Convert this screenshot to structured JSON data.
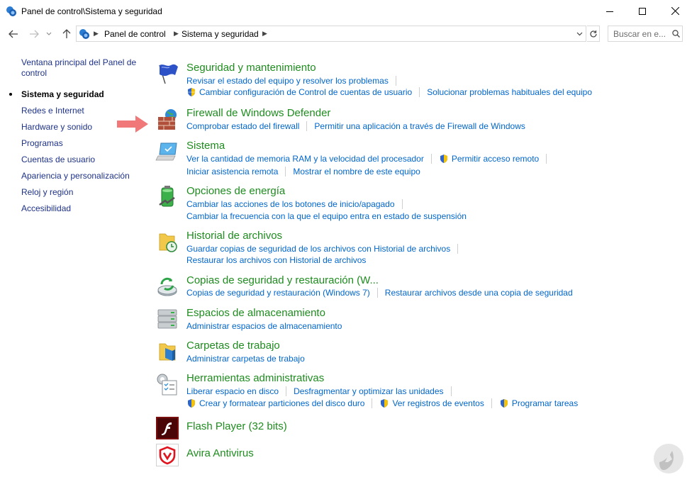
{
  "window": {
    "title": "Panel de control\\Sistema y seguridad",
    "controls": [
      "minimize",
      "maximize",
      "close"
    ]
  },
  "nav": {
    "breadcrumb": [
      "Panel de control",
      "Sistema y seguridad"
    ],
    "search_placeholder": "Buscar en e..."
  },
  "sidebar": {
    "home": "Ventana principal del Panel de control",
    "current": "Sistema y seguridad",
    "items": [
      "Redes e Internet",
      "Hardware y sonido",
      "Programas",
      "Cuentas de usuario",
      "Apariencia y personalización",
      "Reloj y región",
      "Accesibilidad"
    ]
  },
  "categories": [
    {
      "title": "Seguridad y mantenimiento",
      "icon": "flag-icon",
      "lines": [
        [
          {
            "text": "Revisar el estado del equipo y resolver los problemas",
            "shield": false
          }
        ],
        [
          {
            "text": "Cambiar configuración de Control de cuentas de usuario",
            "shield": true
          },
          {
            "text": "Solucionar problemas habituales del equipo",
            "shield": false
          }
        ]
      ]
    },
    {
      "title": "Firewall de Windows Defender",
      "icon": "firewall-icon",
      "lines": [
        [
          {
            "text": "Comprobar estado del firewall",
            "shield": false
          },
          {
            "text": "Permitir una aplicación a través de Firewall de Windows",
            "shield": false
          }
        ]
      ]
    },
    {
      "title": "Sistema",
      "icon": "computer-icon",
      "lines": [
        [
          {
            "text": "Ver la cantidad de memoria RAM y la velocidad del procesador",
            "shield": false
          },
          {
            "text": "Permitir acceso remoto",
            "shield": true
          }
        ],
        [
          {
            "text": "Iniciar asistencia remota",
            "shield": false
          },
          {
            "text": "Mostrar el nombre de este equipo",
            "shield": false
          }
        ]
      ]
    },
    {
      "title": "Opciones de energía",
      "icon": "battery-icon",
      "lines": [
        [
          {
            "text": "Cambiar las acciones de los botones de inicio/apagado",
            "shield": false
          }
        ],
        [
          {
            "text": "Cambiar la frecuencia con la que el equipo entra en estado de suspensión",
            "shield": false
          }
        ]
      ]
    },
    {
      "title": "Historial de archivos",
      "icon": "file-history-icon",
      "lines": [
        [
          {
            "text": "Guardar copias de seguridad de los archivos con Historial de archivos",
            "shield": false
          }
        ],
        [
          {
            "text": "Restaurar los archivos con Historial de archivos",
            "shield": false
          }
        ]
      ]
    },
    {
      "title": "Copias de seguridad y restauración (W...",
      "icon": "backup-icon",
      "lines": [
        [
          {
            "text": "Copias de seguridad y restauración (Windows 7)",
            "shield": false
          },
          {
            "text": "Restaurar archivos desde una copia de seguridad",
            "shield": false
          }
        ]
      ]
    },
    {
      "title": "Espacios de almacenamiento",
      "icon": "storage-icon",
      "lines": [
        [
          {
            "text": "Administrar espacios de almacenamiento",
            "shield": false
          }
        ]
      ]
    },
    {
      "title": "Carpetas de trabajo",
      "icon": "work-folders-icon",
      "lines": [
        [
          {
            "text": "Administrar carpetas de trabajo",
            "shield": false
          }
        ]
      ]
    },
    {
      "title": "Herramientas administrativas",
      "icon": "admin-tools-icon",
      "lines": [
        [
          {
            "text": "Liberar espacio en disco",
            "shield": false
          },
          {
            "text": "Desfragmentar y optimizar las unidades",
            "shield": false
          }
        ],
        [
          {
            "text": "Crear y formatear particiones del disco duro",
            "shield": true
          },
          {
            "text": "Ver registros de eventos",
            "shield": true
          },
          {
            "text": "Programar tareas",
            "shield": true
          }
        ]
      ]
    },
    {
      "title": "Flash Player (32 bits)",
      "icon": "flash-icon",
      "lines": []
    },
    {
      "title": "Avira Antivirus",
      "icon": "avira-icon",
      "lines": []
    }
  ]
}
